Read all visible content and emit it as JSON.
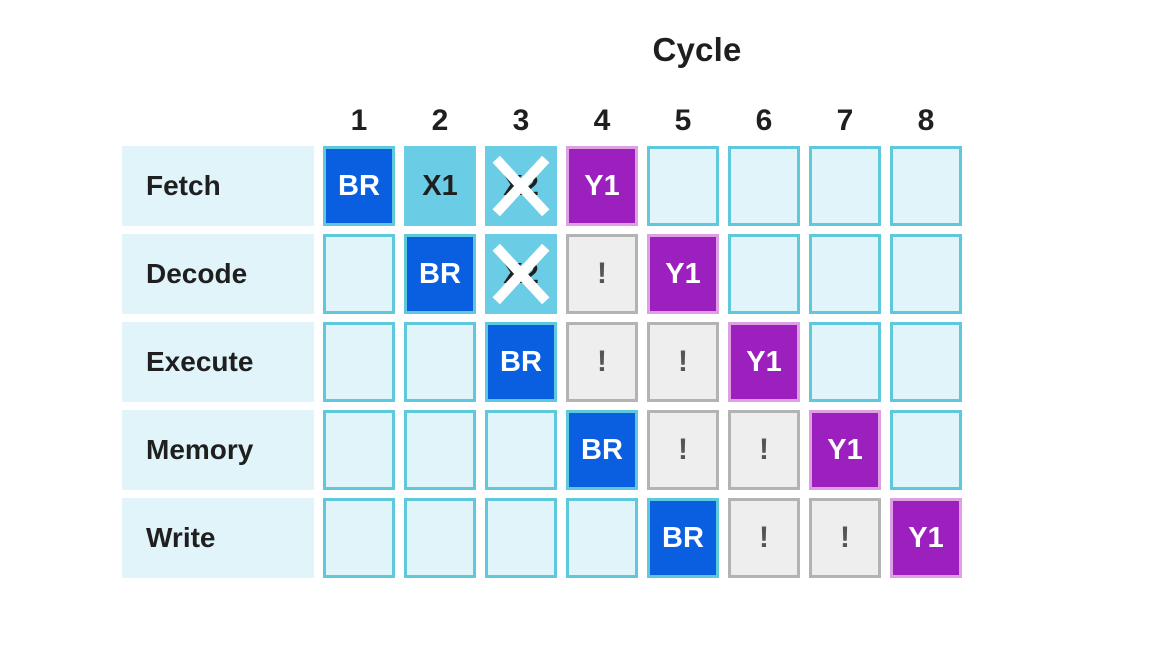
{
  "title": "Cycle",
  "colors": {
    "branch_fill": "#0a5fe0",
    "fetched_fill": "#6bcde5",
    "target_fill": "#9b20be",
    "target_border": "#dfa0e3",
    "stall_fill": "#eeeeee",
    "stall_border": "#b3b3b3",
    "empty_fill": "#e0f4fa",
    "empty_border": "#5ec8dd",
    "label_band": "#e0f4fa",
    "text_dark": "#1f1f1f",
    "kill_stroke": "#ffffff"
  },
  "legend_icons": {
    "kill": "x-strike-icon",
    "stall": "exclamation-icon"
  },
  "chart_data": {
    "type": "table",
    "title": "Cycle",
    "xlabel": "Cycle",
    "ylabel": "",
    "columns": [
      "1",
      "2",
      "3",
      "4",
      "5",
      "6",
      "7",
      "8"
    ],
    "rows": [
      "Fetch",
      "Decode",
      "Execute",
      "Memory",
      "Write"
    ],
    "cells": [
      [
        {
          "label": "BR",
          "state": "branch"
        },
        {
          "label": "X1",
          "state": "fetched"
        },
        {
          "label": "X2",
          "state": "squashed"
        },
        {
          "label": "Y1",
          "state": "target"
        },
        {
          "label": "",
          "state": "empty"
        },
        {
          "label": "",
          "state": "empty"
        },
        {
          "label": "",
          "state": "empty"
        },
        {
          "label": "",
          "state": "empty"
        }
      ],
      [
        {
          "label": "",
          "state": "empty"
        },
        {
          "label": "BR",
          "state": "branch"
        },
        {
          "label": "X2",
          "state": "squashed"
        },
        {
          "label": "!",
          "state": "stall"
        },
        {
          "label": "Y1",
          "state": "target"
        },
        {
          "label": "",
          "state": "empty"
        },
        {
          "label": "",
          "state": "empty"
        },
        {
          "label": "",
          "state": "empty"
        }
      ],
      [
        {
          "label": "",
          "state": "empty"
        },
        {
          "label": "",
          "state": "empty"
        },
        {
          "label": "BR",
          "state": "branch"
        },
        {
          "label": "!",
          "state": "stall"
        },
        {
          "label": "!",
          "state": "stall"
        },
        {
          "label": "Y1",
          "state": "target"
        },
        {
          "label": "",
          "state": "empty"
        },
        {
          "label": "",
          "state": "empty"
        }
      ],
      [
        {
          "label": "",
          "state": "empty"
        },
        {
          "label": "",
          "state": "empty"
        },
        {
          "label": "",
          "state": "empty"
        },
        {
          "label": "BR",
          "state": "branch"
        },
        {
          "label": "!",
          "state": "stall"
        },
        {
          "label": "!",
          "state": "stall"
        },
        {
          "label": "Y1",
          "state": "target"
        },
        {
          "label": "",
          "state": "empty"
        }
      ],
      [
        {
          "label": "",
          "state": "empty"
        },
        {
          "label": "",
          "state": "empty"
        },
        {
          "label": "",
          "state": "empty"
        },
        {
          "label": "",
          "state": "empty"
        },
        {
          "label": "BR",
          "state": "branch"
        },
        {
          "label": "!",
          "state": "stall"
        },
        {
          "label": "!",
          "state": "stall"
        },
        {
          "label": "Y1",
          "state": "target"
        }
      ]
    ]
  }
}
